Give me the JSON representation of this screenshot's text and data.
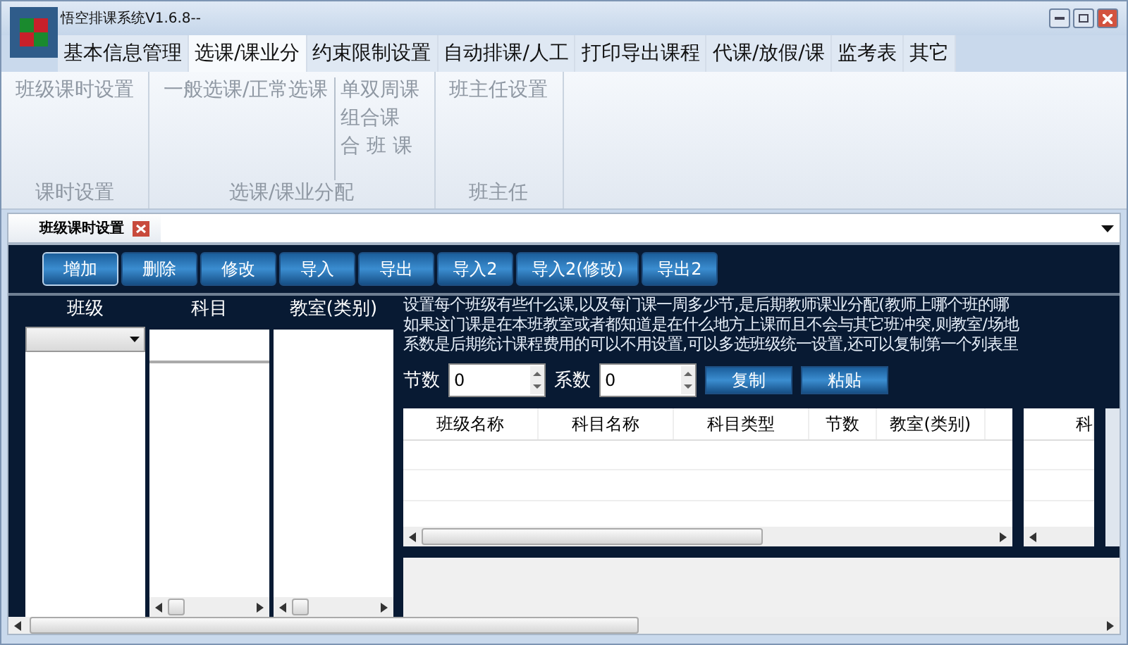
{
  "window": {
    "title": "悟空排课系统V1.6.8--"
  },
  "menu_tabs": [
    {
      "label": "基本信息管理",
      "selected": false
    },
    {
      "label": "选课/课业分",
      "selected": true
    },
    {
      "label": "约束限制设置",
      "selected": false
    },
    {
      "label": "自动排课/人工",
      "selected": false
    },
    {
      "label": "打印导出课程",
      "selected": false
    },
    {
      "label": "代课/放假/课",
      "selected": false
    },
    {
      "label": "监考表",
      "selected": false
    },
    {
      "label": "其它",
      "selected": false
    }
  ],
  "ribbon_groups": [
    {
      "columns": [
        [
          "班级课时设置"
        ]
      ],
      "label": "课时设置"
    },
    {
      "columns": [
        [
          "一般选课/正常选课"
        ],
        [
          "单双周课",
          "组合课",
          "合 班 课"
        ]
      ],
      "label": "选课/课业分配"
    },
    {
      "columns": [
        [
          "班主任设置"
        ]
      ],
      "label": "班主任"
    }
  ],
  "document_tab": {
    "label": "班级课时设置"
  },
  "toolbar": [
    {
      "label": "增加",
      "selected": true
    },
    {
      "label": "删除",
      "selected": false
    },
    {
      "label": "修改",
      "selected": false
    },
    {
      "label": "导入",
      "selected": false
    },
    {
      "label": "导出",
      "selected": false
    },
    {
      "label": "导入2",
      "selected": false
    },
    {
      "label": "导入2(修改)",
      "selected": false
    },
    {
      "label": "导出2",
      "selected": false
    }
  ],
  "lists": [
    {
      "label": "班级",
      "kind": "combo"
    },
    {
      "label": "科目",
      "kind": "input"
    },
    {
      "label": "教室(类别)",
      "kind": "plain"
    }
  ],
  "description": [
    "设置每个班级有些什么课,以及每门课一周多少节,是后期教师课业分配(教师上哪个班的哪",
    "如果这门课是在本班教室或者都知道是在什么地方上课而且不会与其它班冲突,则教室/场地",
    "系数是后期统计课程费用的可以不用设置,可以多选班级统一设置,还可以复制第一个列表里"
  ],
  "spinners": [
    {
      "label": "节数",
      "value": "0"
    },
    {
      "label": "系数",
      "value": "0"
    }
  ],
  "action_buttons": [
    "复制",
    "粘贴"
  ],
  "table": {
    "columns": [
      "班级名称",
      "科目名称",
      "科目类型",
      "节数",
      "教室(类别)"
    ]
  },
  "side_table": {
    "columns": [
      "科"
    ]
  }
}
